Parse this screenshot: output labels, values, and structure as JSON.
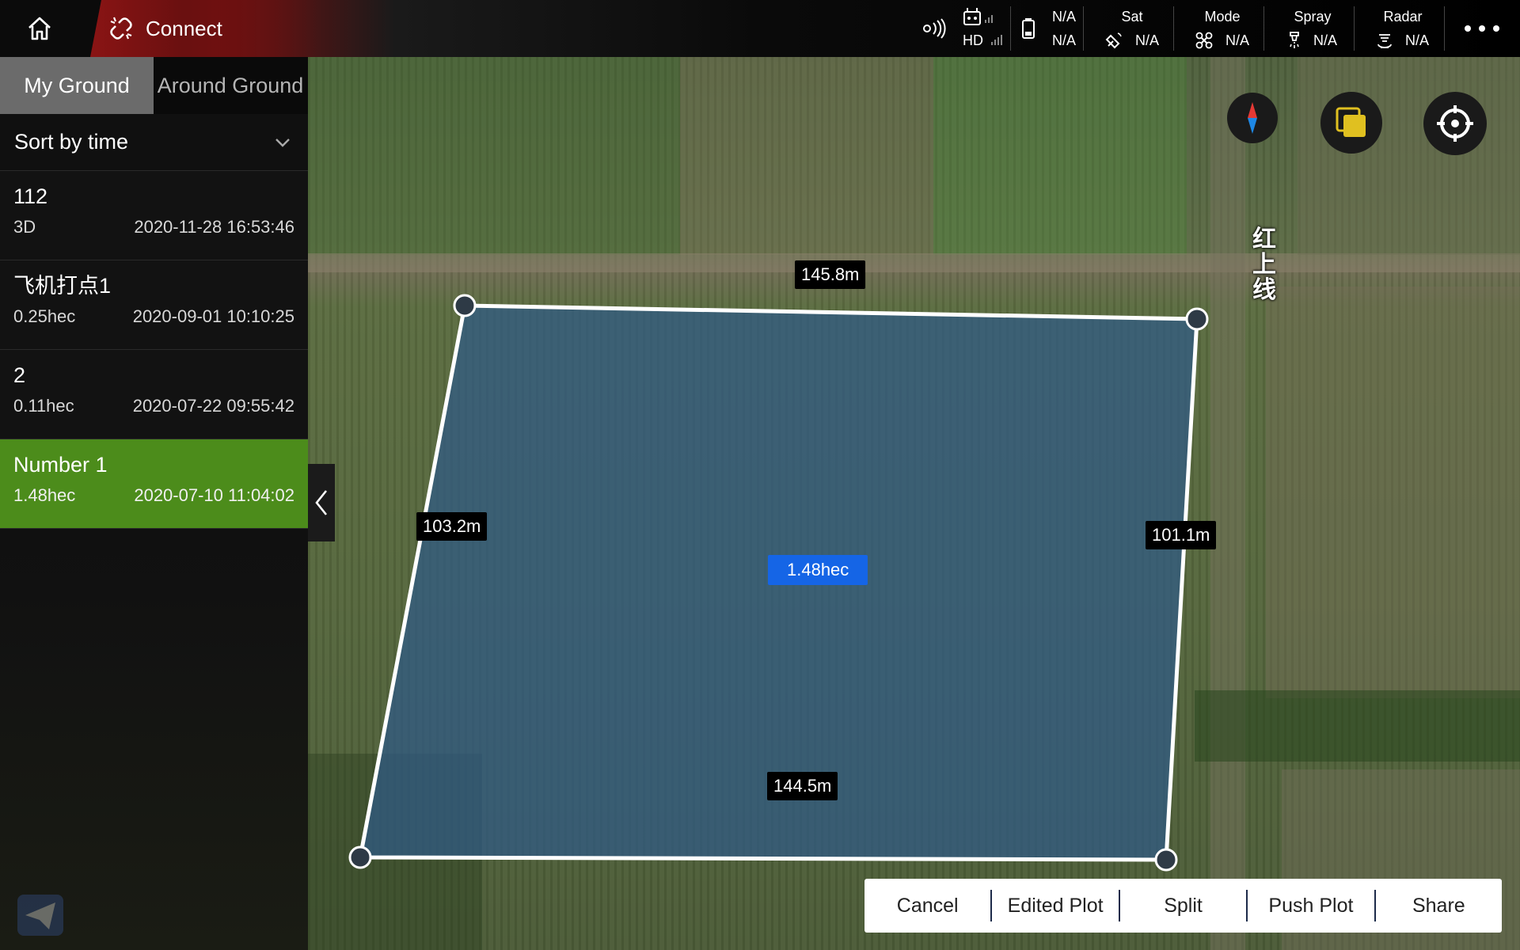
{
  "topbar": {
    "connect_label": "Connect",
    "hd_label": "HD",
    "battery_value_1": "N/A",
    "battery_value_2": "N/A",
    "sat": {
      "label": "Sat",
      "value": "N/A"
    },
    "mode": {
      "label": "Mode",
      "value": "N/A"
    },
    "spray": {
      "label": "Spray",
      "value": "N/A"
    },
    "radar": {
      "label": "Radar",
      "value": "N/A"
    }
  },
  "sidebar": {
    "tabs": [
      {
        "label": "My Ground",
        "active": true
      },
      {
        "label": "Around Ground",
        "active": false
      }
    ],
    "sort_label": "Sort by time",
    "plots": [
      {
        "name": "112",
        "size": "3D",
        "date": "2020-11-28 16:53:46",
        "selected": false
      },
      {
        "name": "飞机打点1",
        "size": "0.25hec",
        "date": "2020-09-01 10:10:25",
        "selected": false
      },
      {
        "name": "2",
        "size": "0.11hec",
        "date": "2020-07-22 09:55:42",
        "selected": false
      },
      {
        "name": "Number 1",
        "size": "1.48hec",
        "date": "2020-07-10 11:04:02",
        "selected": true
      }
    ]
  },
  "map": {
    "place_label": "红上线",
    "edges": {
      "top": "145.8m",
      "left": "103.2m",
      "right": "101.1m",
      "bottom": "144.5m"
    },
    "area": "1.48hec",
    "polygon_fill": "#2f5a86",
    "area_tag_color": "#1565e6"
  },
  "toolbar": {
    "cancel": "Cancel",
    "edited_plot": "Edited Plot",
    "split": "Split",
    "push_plot": "Push Plot",
    "share": "Share"
  }
}
